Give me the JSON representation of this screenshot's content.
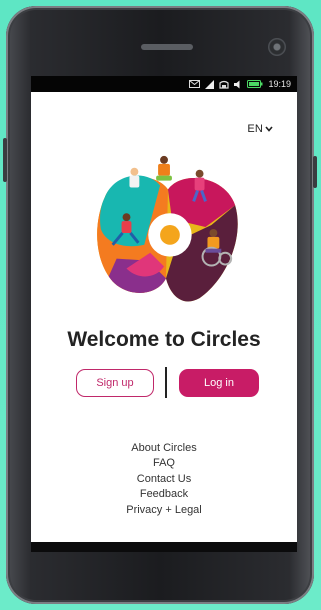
{
  "status_bar": {
    "time": "19:19",
    "icons": [
      "mail-icon",
      "signal-icon",
      "wifi-icon",
      "volume-icon",
      "battery-icon"
    ]
  },
  "language": {
    "label": "EN"
  },
  "welcome": {
    "title": "Welcome to Circles"
  },
  "actions": {
    "signup_label": "Sign up",
    "login_label": "Log in"
  },
  "links": [
    "About Circles",
    "FAQ",
    "Contact Us",
    "Feedback",
    "Privacy + Legal"
  ],
  "colors": {
    "accent": "#c81c66",
    "outline": "#c0286a",
    "background": "#6cebc9"
  }
}
